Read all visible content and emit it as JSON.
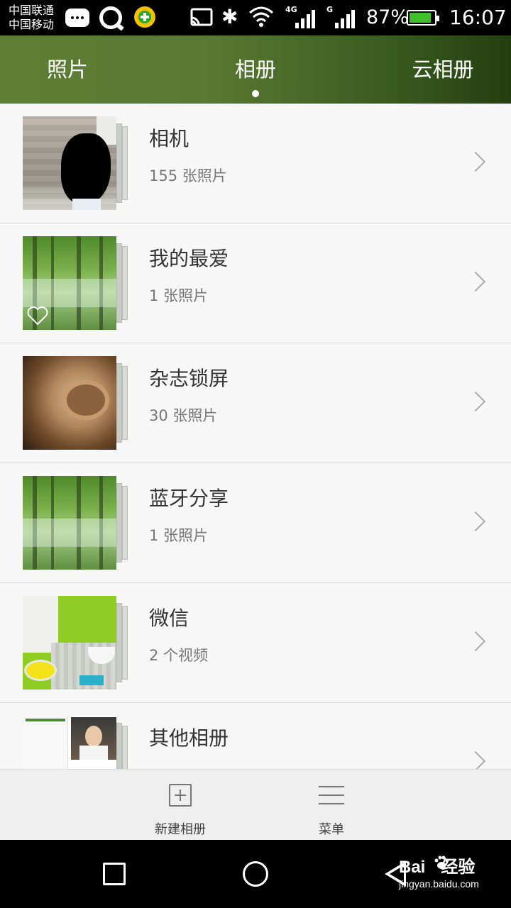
{
  "status_bar": {
    "carrier_1": "中国联通",
    "carrier_2": "中国移动",
    "signal_1_type": "4G",
    "signal_2_type": "G",
    "battery": "87%",
    "time": "16:07",
    "battery_color": "#3fbf2a"
  },
  "tabs": [
    {
      "label": "照片",
      "active": false
    },
    {
      "label": "相册",
      "active": true
    },
    {
      "label": "云相册",
      "active": false
    }
  ],
  "albums": [
    {
      "name": "相机",
      "count": "155 张照片",
      "thumb": "camera-thumbnail"
    },
    {
      "name": "我的最爱",
      "count": "1 张照片",
      "thumb": "forest-thumbnail",
      "badge": "heart-icon"
    },
    {
      "name": "杂志锁屏",
      "count": "30 张照片",
      "thumb": "pottery-thumbnail"
    },
    {
      "name": "蓝牙分享",
      "count": "1 张照片",
      "thumb": "forest-thumbnail"
    },
    {
      "name": "微信",
      "count": "2 个视频",
      "thumb": "bathroom-thumbnail"
    },
    {
      "name": "其他相册",
      "count": "",
      "thumb": "collage-thumbnail"
    }
  ],
  "toolbar": {
    "new_album_label": "新建相册",
    "menu_label": "菜单"
  },
  "watermark": {
    "brand": "Bai",
    "brand_suffix": "经验",
    "url": "jingyan.baidu.com"
  },
  "theme": {
    "header_gradient_start": "#5d7f35",
    "header_gradient_end": "#233f10"
  }
}
